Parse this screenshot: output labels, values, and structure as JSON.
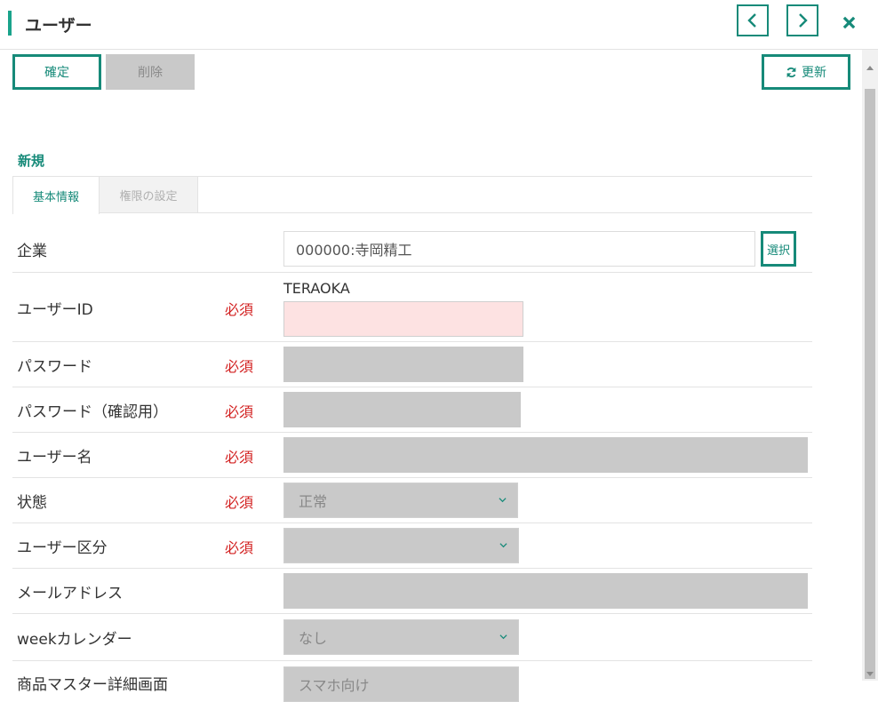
{
  "header": {
    "title": "ユーザー"
  },
  "toolbar": {
    "confirm_label": "確定",
    "delete_label": "削除",
    "refresh_label": "更新"
  },
  "section": {
    "title": "新規"
  },
  "tabs": [
    {
      "label": "基本情報"
    },
    {
      "label": "権限の設定"
    }
  ],
  "form": {
    "company": {
      "label": "企業",
      "value": "000000:寺岡精工",
      "select_button": "選択"
    },
    "user_id": {
      "label": "ユーザーID",
      "required": "必須",
      "hint_value": "TERAOKA",
      "value": ""
    },
    "password": {
      "label": "パスワード",
      "required": "必須"
    },
    "password_confirm": {
      "label": "パスワード（確認用）",
      "required": "必須"
    },
    "user_name": {
      "label": "ユーザー名",
      "required": "必須"
    },
    "status": {
      "label": "状態",
      "required": "必須",
      "value": "正常"
    },
    "user_type": {
      "label": "ユーザー区分",
      "required": "必須",
      "value": ""
    },
    "email": {
      "label": "メールアドレス"
    },
    "week_calendar": {
      "label": "weekカレンダー",
      "value": "なし"
    },
    "product_master": {
      "label": "商品マスター詳細画面",
      "value": "スマホ向け"
    }
  },
  "colors": {
    "accent": "#168a79",
    "required": "#d21f1f",
    "disabled": "#c9c9c9"
  }
}
